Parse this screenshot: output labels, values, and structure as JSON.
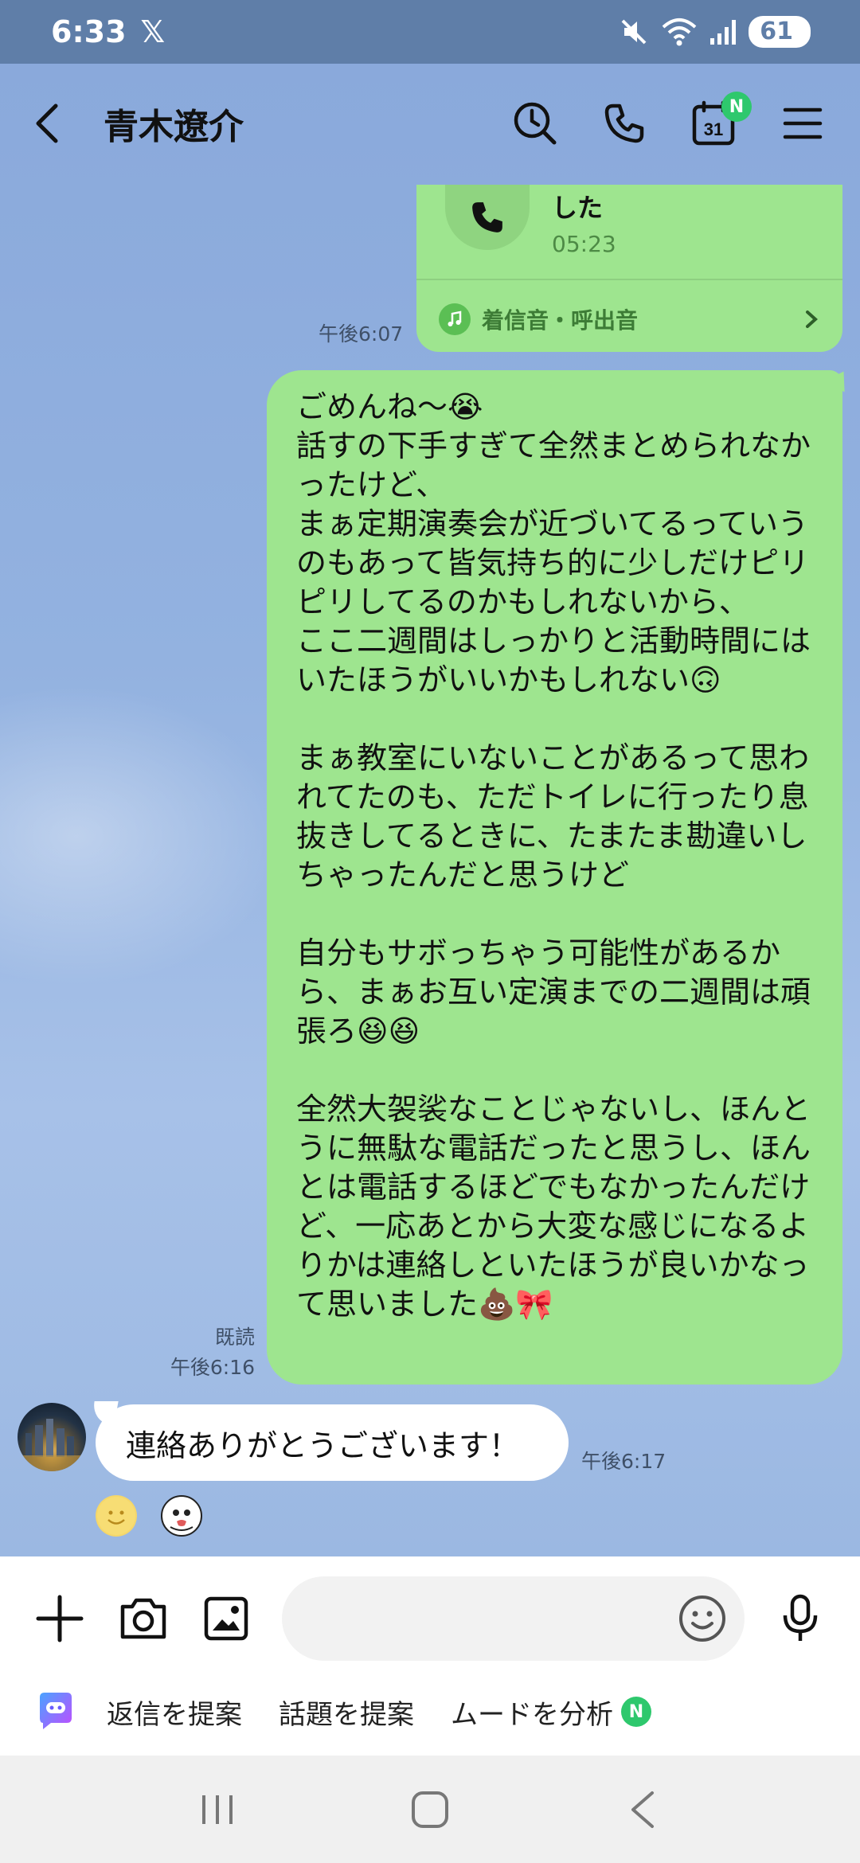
{
  "status_bar": {
    "time": "6:33",
    "x_logo": "𝕏",
    "battery": "61"
  },
  "header": {
    "contact_name": "青木遼介",
    "calendar_day": "31",
    "calendar_badge": "N"
  },
  "call_card": {
    "title": "した",
    "duration": "05:23",
    "ringtone_label": "着信音・呼出音"
  },
  "messages": {
    "call_time": "午後6:07",
    "sent_text": "ごめんね〜😭\n話すの下手すぎて全然まとめられなかったけど、\nまぁ定期演奏会が近づいてるっていうのもあって皆気持ち的に少しだけピリピリしてるのかもしれないから、\nここ二週間はしっかりと活動時間にはいたほうがいいかもしれない🙃\n\nまぁ教室にいないことがあるって思われてたのも、ただトイレに行ったり息抜きしてるときに、たまたま勘違いしちゃったんだと思うけど\n\n自分もサボっちゃう可能性があるから、まぁお互い定演までの二週間は頑張ろ😆😆\n\n全然大袈裟なことじゃないし、ほんとうに無駄な電話だったと思うし、ほんとは電話するほどでもなかったんだけど、一応あとから大変な感じになるよりかは連絡しといたほうが良いかなって思いました💩🎀",
    "read_status": "既読",
    "sent_time": "午後6:16",
    "received_text": "連絡ありがとうございます！",
    "received_time": "午後6:17"
  },
  "input": {
    "placeholder": ""
  },
  "ai_suggestions": {
    "suggest_reply": "返信を提案",
    "suggest_topic": "話題を提案",
    "analyze_mood": "ムードを分析",
    "analyze_badge": "N"
  },
  "colors": {
    "sent_bubble": "#9ee58f",
    "chat_background": "#8eaedc",
    "status_bar": "#5f7ea8",
    "badge_green": "#2ec86d"
  }
}
